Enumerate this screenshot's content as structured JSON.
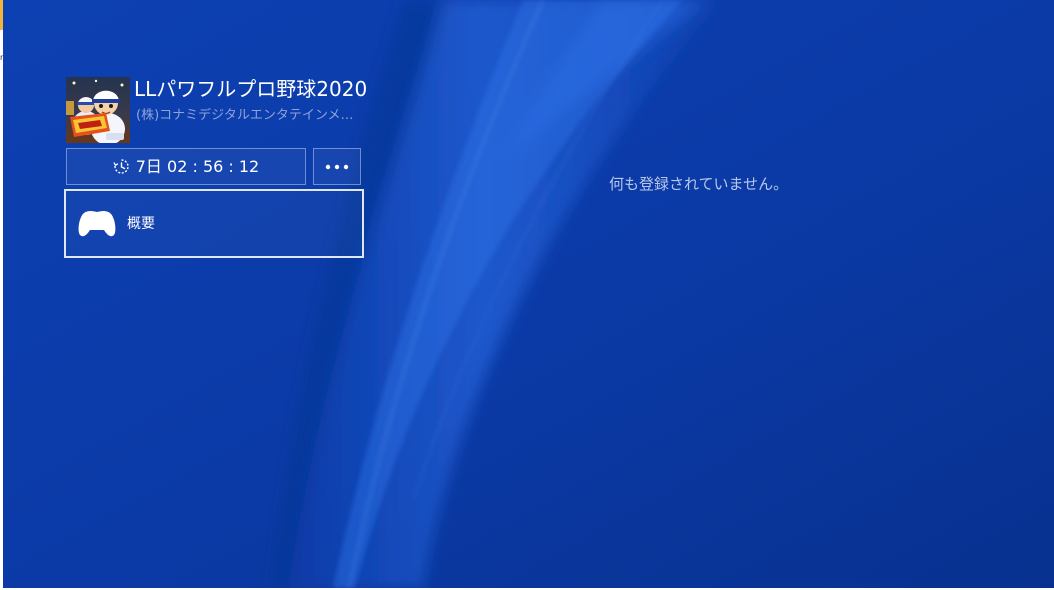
{
  "edge": {
    "fragment_text": "r"
  },
  "game": {
    "title": "LLパワフルプロ野球2020",
    "publisher": "(株)コナミデジタルエンタテインメ…",
    "cover_icon": "game-cover-art"
  },
  "timer_button": {
    "icon": "clock-icon",
    "label": "7日 02 : 56 : 12"
  },
  "more_button": {
    "icon": "more-options-icon"
  },
  "menu": {
    "items": [
      {
        "icon": "controller-icon",
        "label": "概要",
        "selected": true
      }
    ]
  },
  "content": {
    "empty_message": "何も登録されていません。"
  },
  "colors": {
    "background": "#0b3aa8",
    "wave_highlight": "#2b72e6",
    "text_primary": "#ffffff",
    "text_secondary": "#8fa3d8",
    "focus_border": "#dfe6f5"
  }
}
